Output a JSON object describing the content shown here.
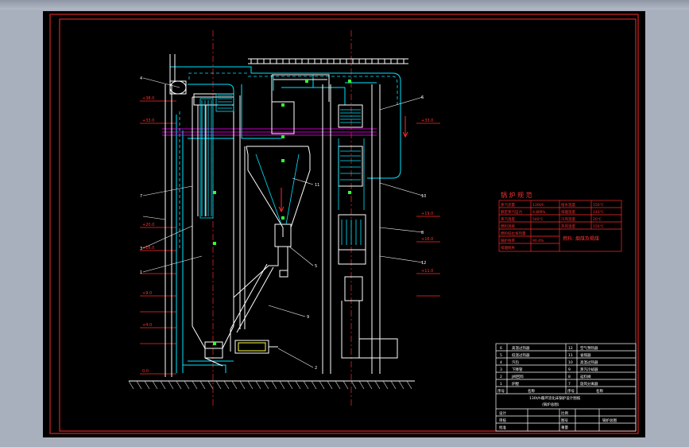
{
  "spec_table": {
    "title": "锅 炉 规 范",
    "rows": [
      [
        "蒸汽流量",
        "130t/h",
        "给水温度",
        "150℃"
      ],
      [
        "额定蒸汽压力",
        "9.8MPa",
        "排烟温度",
        "140℃"
      ],
      [
        "蒸汽温度",
        "540℃",
        "冷风温度",
        "20℃"
      ],
      [
        "燃料消耗",
        "",
        "热风温度",
        "150℃"
      ],
      [
        "燃料低位发热量",
        "",
        "",
        ""
      ],
      [
        "锅炉效率",
        "90.4%",
        "",
        ""
      ],
      [
        "排烟损失",
        "",
        "",
        ""
      ]
    ],
    "note": "燃料: 烟煤及褐煤"
  },
  "parts_list": {
    "rows": [
      [
        "6",
        "高温过热器",
        "12",
        "空气预热器"
      ],
      [
        "5",
        "低温过热器",
        "11",
        "省煤器"
      ],
      [
        "4",
        "汽包",
        "10",
        "高温过热器"
      ],
      [
        "3",
        "下降管",
        "9",
        "蒸汽冷却器"
      ],
      [
        "2",
        "J阀回料",
        "8",
        "返料阀"
      ],
      [
        "1",
        "炉膛",
        "7",
        "旋风分离器"
      ]
    ],
    "header": [
      "序号",
      "名称",
      "序号",
      "名称"
    ],
    "title_line1": "130t/h循环流化床锅炉设计图纸",
    "title_line2": "(锅炉总图)",
    "sign_rows": [
      [
        "设计",
        "",
        "比例"
      ],
      [
        "审核",
        "",
        "图号"
      ],
      [
        "批准",
        "",
        "重量"
      ]
    ],
    "drawing_name": "锅炉总图"
  },
  "annotations": {
    "numbers": [
      "4",
      "6",
      "7",
      "5",
      "3",
      "1",
      "2",
      "8",
      "9",
      "10",
      "11",
      "12"
    ]
  },
  "colors": {
    "frame": "#ff2a2a",
    "outline": "#ffffff",
    "pipe": "#00e5ff",
    "accent": "#ff00ff",
    "marker": "#33ff33",
    "background": "#000000"
  }
}
